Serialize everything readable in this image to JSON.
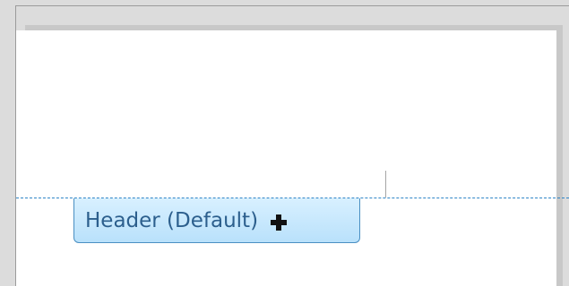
{
  "header_tag": {
    "label": "Header (Default)",
    "icon": "plus-icon"
  },
  "colors": {
    "tag_background": "#c9e8fd",
    "tag_border": "#4a8fc2",
    "tag_text": "#2c5f8d",
    "boundary_line": "#2f86c7",
    "page": "#ffffff",
    "workspace": "#dcdcdc"
  }
}
